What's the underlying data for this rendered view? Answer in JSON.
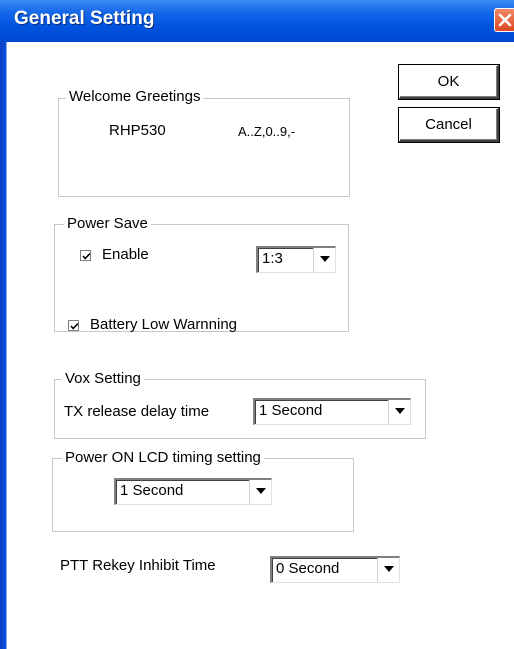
{
  "window": {
    "title": "General Setting"
  },
  "buttons": {
    "ok": "OK",
    "cancel": "Cancel"
  },
  "welcome": {
    "legend": "Welcome Greetings",
    "value": "RHP530",
    "hint": "A..Z,0..9,-"
  },
  "power_save": {
    "legend": "Power Save",
    "enable_label": "Enable",
    "enable_checked": true,
    "ratio": "1:3"
  },
  "battery": {
    "label": "Battery Low Warnning",
    "checked": true
  },
  "vox": {
    "legend": "Vox Setting",
    "delay_label": "TX release delay time",
    "delay_value": "1 Second"
  },
  "lcd": {
    "legend": "Power ON LCD timing setting",
    "value": "1 Second"
  },
  "ptt": {
    "label": "PTT Rekey Inhibit Time",
    "value": "0 Second"
  },
  "icons": {
    "close": "close-icon",
    "dropdown": "chevron-down-icon",
    "check": "checkmark-icon"
  },
  "colors": {
    "titlebar": "#0055e0",
    "close_button": "#d9471f",
    "background": "#ffffff"
  }
}
